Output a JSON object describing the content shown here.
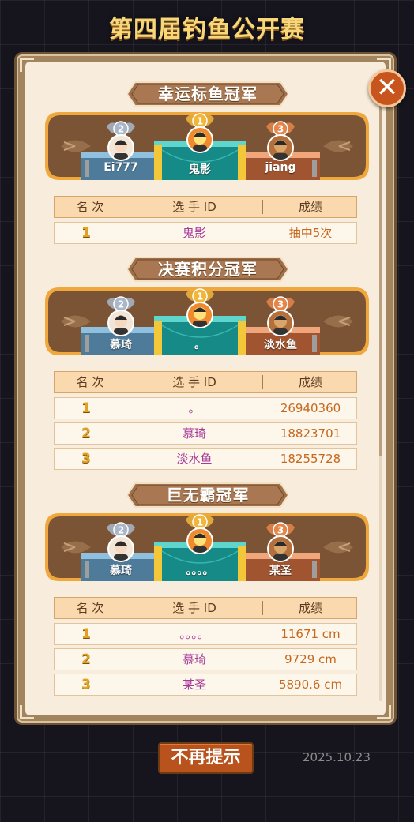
{
  "title": "第四届钓鱼公开赛",
  "close_icon": "close-icon",
  "table_headers": {
    "rank": "名 次",
    "player": "选 手 ID",
    "score": "成绩"
  },
  "sections": [
    {
      "title": "幸运标鱼冠军",
      "podium": {
        "first": "鬼影",
        "second": "Ei777",
        "third": "jiang"
      },
      "rows": [
        {
          "rank": "1",
          "player": "鬼影",
          "score": "抽中5次"
        }
      ]
    },
    {
      "title": "决赛积分冠军",
      "podium": {
        "first": "。",
        "second": "慕琦",
        "third": "淡水鱼"
      },
      "rows": [
        {
          "rank": "1",
          "player": "。",
          "score": "26940360"
        },
        {
          "rank": "2",
          "player": "慕琦",
          "score": "18823701"
        },
        {
          "rank": "3",
          "player": "淡水鱼",
          "score": "18255728"
        }
      ]
    },
    {
      "title": "巨无霸冠军",
      "podium": {
        "first": "。。。。",
        "second": "慕琦",
        "third": "某圣"
      },
      "rows": [
        {
          "rank": "1",
          "player": "。。。。",
          "score": "11671 cm"
        },
        {
          "rank": "2",
          "player": "慕琦",
          "score": "9729 cm"
        },
        {
          "rank": "3",
          "player": "某圣",
          "score": "5890.6 cm"
        }
      ]
    }
  ],
  "footer": {
    "button": "不再提示",
    "date": "2025.10.23"
  },
  "colors": {
    "accent": "#b8531e",
    "rank": "#e2a320",
    "player": "#a63a98",
    "score": "#c7681f"
  }
}
